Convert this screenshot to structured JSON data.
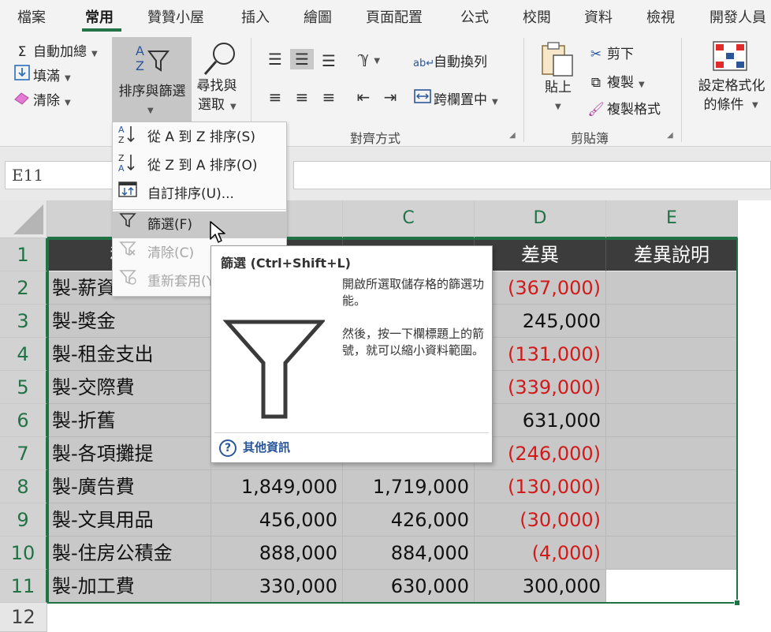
{
  "ribbon_tabs": [
    "檔案",
    "常用",
    "贊贊小屋",
    "插入",
    "繪圖",
    "頁面配置",
    "公式",
    "校閱",
    "資料",
    "檢視",
    "開發人員"
  ],
  "ribbon": {
    "autosum": "自動加總",
    "fill": "填滿",
    "clear": "清除",
    "sort_filter_line1": "排序與篩選",
    "find_select_line1": "尋找與",
    "find_select_line2": "選取",
    "wrap_text": "自動換列",
    "merge_center": "跨欄置中",
    "alignment_group": "對齊方式",
    "paste": "貼上",
    "cut": "剪下",
    "copy": "複製",
    "format_painter": "複製格式",
    "clipboard_group": "剪貼簿",
    "cond_format_line1": "設定格式化",
    "cond_format_line2": "的條件"
  },
  "name_box": "E11",
  "sort_menu": {
    "items": [
      {
        "label": "從 A 到 Z 排序(S)",
        "state": "normal"
      },
      {
        "label": "從 Z 到 A 排序(O)",
        "state": "normal"
      },
      {
        "label": "自訂排序(U)...",
        "state": "normal"
      },
      {
        "label": "篩選(F)",
        "state": "hover"
      },
      {
        "label": "清除(C)",
        "state": "disabled"
      },
      {
        "label": "重新套用(Y)",
        "state": "disabled"
      }
    ]
  },
  "tooltip": {
    "title": "篩選 (Ctrl+Shift+L)",
    "desc1": "開啟所選取儲存格的篩選功能。",
    "desc2": "然後，按一下欄標題上的箭號，就可以縮小資料範圍。",
    "help": "其他資訊"
  },
  "sheet": {
    "columns": [
      "A",
      "B",
      "C",
      "D",
      "E"
    ],
    "rows": [
      "1",
      "2",
      "3",
      "4",
      "5",
      "6",
      "7",
      "8",
      "9",
      "10",
      "11",
      "12"
    ],
    "header_cells": [
      "科目",
      "",
      "",
      "差異",
      "差異說明"
    ],
    "data": [
      [
        "製-薪資",
        "",
        "",
        "(367,000)",
        ""
      ],
      [
        "製-獎金",
        "",
        "",
        "245,000",
        ""
      ],
      [
        "製-租金支出",
        "",
        "",
        "(131,000)",
        ""
      ],
      [
        "製-交際費",
        "",
        "",
        "(339,000)",
        ""
      ],
      [
        "製-折舊",
        "",
        "",
        "631,000",
        ""
      ],
      [
        "製-各項攤提",
        "",
        "",
        "(246,000)",
        ""
      ],
      [
        "製-廣告費",
        "1,849,000",
        "1,719,000",
        "(130,000)",
        ""
      ],
      [
        "製-文具用品",
        "456,000",
        "426,000",
        "(30,000)",
        ""
      ],
      [
        "製-住房公積金",
        "888,000",
        "884,000",
        "(4,000)",
        ""
      ],
      [
        "製-加工費",
        "330,000",
        "630,000",
        "300,000",
        ""
      ]
    ]
  },
  "colors": {
    "accent": "#217346",
    "negative": "#d11a1a",
    "header_bg": "#3c3c3c",
    "selection": "#c8c8c8"
  }
}
